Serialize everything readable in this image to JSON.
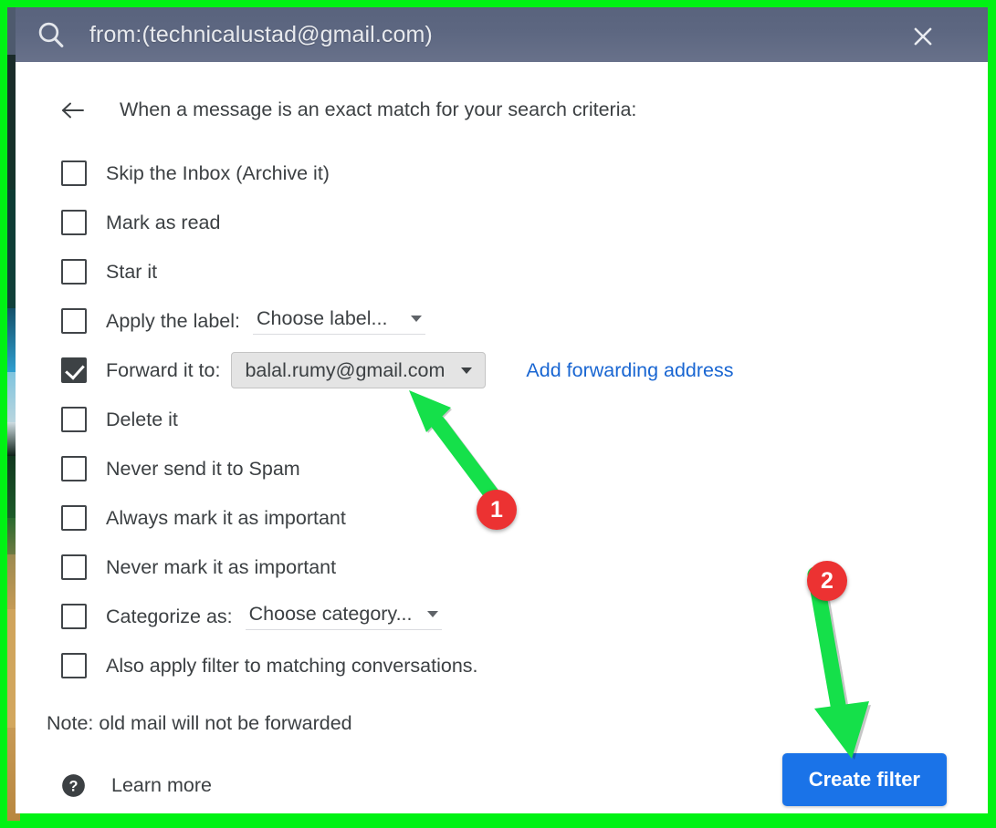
{
  "window": {
    "border_color": "#00f214",
    "accent_blue": "#1a73e8",
    "link_blue": "#1966d2",
    "header_bg": "#5d6781"
  },
  "search_bar": {
    "icon": "search-icon",
    "query": "from:(technicalustad@gmail.com)",
    "close_icon": "close-icon"
  },
  "dialog": {
    "back_icon": "arrow-left-icon",
    "criteria_title": "When a message is an exact match for your search criteria:",
    "actions": [
      {
        "id": "skip-inbox",
        "label": "Skip the Inbox (Archive it)",
        "checked": false
      },
      {
        "id": "mark-as-read",
        "label": "Mark as read",
        "checked": false
      },
      {
        "id": "star-it",
        "label": "Star it",
        "checked": false
      },
      {
        "id": "apply-label",
        "label": "Apply the label:",
        "checked": false,
        "select": "Choose label..."
      },
      {
        "id": "forward-it-to",
        "label": "Forward it to:",
        "checked": true,
        "select": "balal.rumy@gmail.com"
      },
      {
        "id": "delete-it",
        "label": "Delete it",
        "checked": false
      },
      {
        "id": "never-send-to-spam",
        "label": "Never send it to Spam",
        "checked": false
      },
      {
        "id": "always-important",
        "label": "Always mark it as important",
        "checked": false
      },
      {
        "id": "never-important",
        "label": "Never mark it as important",
        "checked": false
      },
      {
        "id": "categorize-as",
        "label": "Categorize as:",
        "checked": false,
        "select": "Choose category..."
      },
      {
        "id": "also-apply-filter",
        "label": "Also apply filter to matching conversations.",
        "checked": false
      }
    ],
    "add_forwarding_link": "Add forwarding address",
    "note": "Note: old mail will not be forwarded",
    "help_icon": "help-circle-icon",
    "learn_more": "Learn more",
    "create_filter_button": "Create filter"
  },
  "annotations": {
    "color": "#15e04a",
    "badge_color": "#ec3232",
    "steps": [
      {
        "number": "1",
        "points_at": "forward-address-select"
      },
      {
        "number": "2",
        "points_at": "create-filter-button"
      }
    ]
  }
}
